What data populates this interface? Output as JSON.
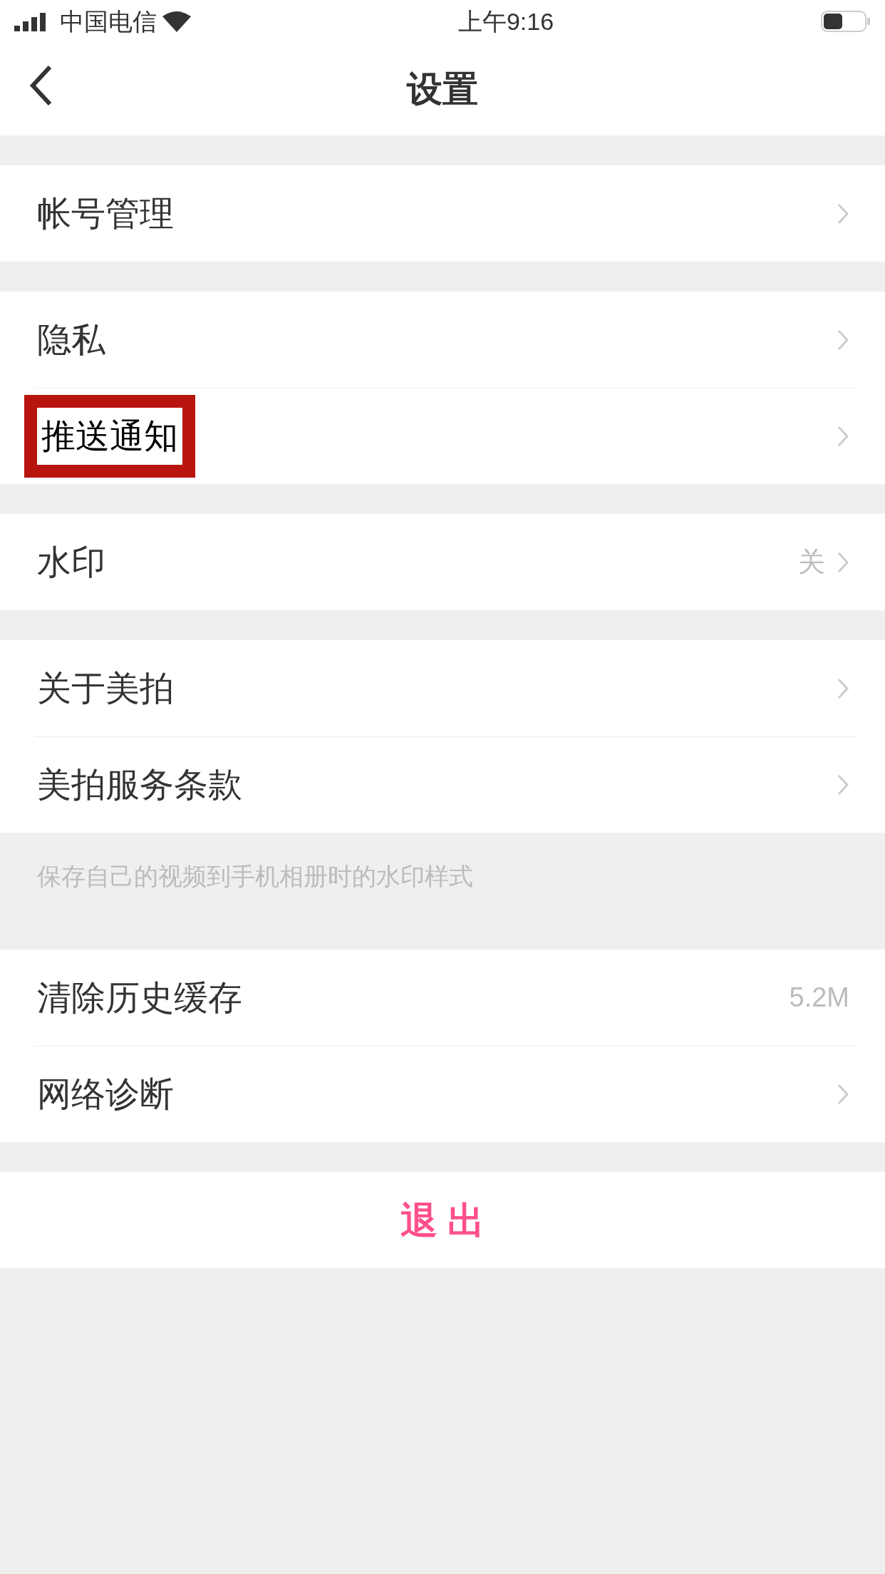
{
  "status_bar": {
    "carrier": "中国电信",
    "time": "上午9:16"
  },
  "nav": {
    "title": "设置"
  },
  "sections": [
    {
      "items": [
        {
          "label": "帐号管理",
          "highlighted": false
        }
      ]
    },
    {
      "items": [
        {
          "label": "隐私",
          "highlighted": false
        },
        {
          "label": "推送通知",
          "highlighted": true
        }
      ]
    },
    {
      "items": [
        {
          "label": "水印",
          "value": "关",
          "highlighted": false
        }
      ]
    },
    {
      "items": [
        {
          "label": "关于美拍",
          "highlighted": false
        },
        {
          "label": "美拍服务条款",
          "highlighted": false
        }
      ],
      "footer": "保存自己的视频到手机相册时的水印样式"
    },
    {
      "items": [
        {
          "label": "清除历史缓存",
          "value": "5.2M",
          "chevron": false,
          "highlighted": false
        },
        {
          "label": "网络诊断",
          "highlighted": false
        }
      ]
    }
  ],
  "logout": {
    "label": "退 出"
  }
}
